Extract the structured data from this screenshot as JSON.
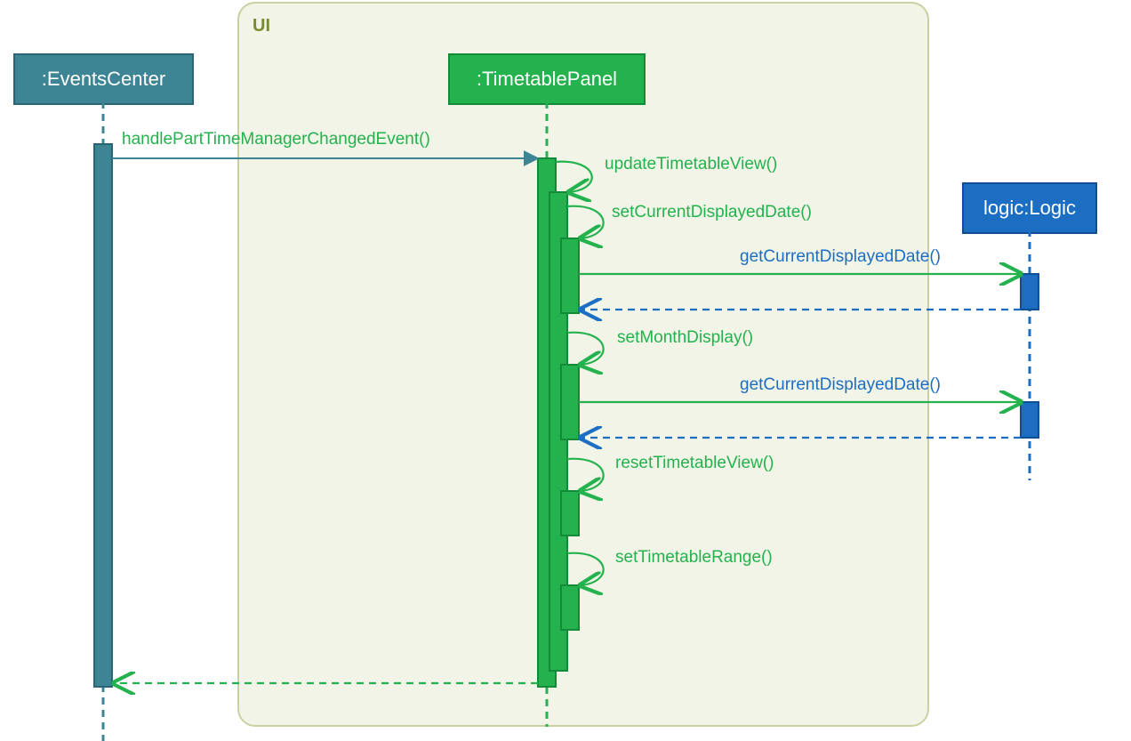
{
  "ui_frame": {
    "label": "UI"
  },
  "participants": {
    "events_center": {
      "label": ":EventsCenter"
    },
    "timetable_panel": {
      "label": ":TimetablePanel"
    },
    "logic": {
      "label": "logic:Logic"
    }
  },
  "messages": {
    "handle_changed": "handlePartTimeManagerChangedEvent()",
    "update_view": "updateTimetableView()",
    "set_current_date": "setCurrentDisplayedDate()",
    "get_current_date_1": "getCurrentDisplayedDate()",
    "set_month": "setMonthDisplay()",
    "get_current_date_2": "getCurrentDisplayedDate()",
    "reset_view": "resetTimetableView()",
    "set_range": "setTimetableRange()"
  }
}
